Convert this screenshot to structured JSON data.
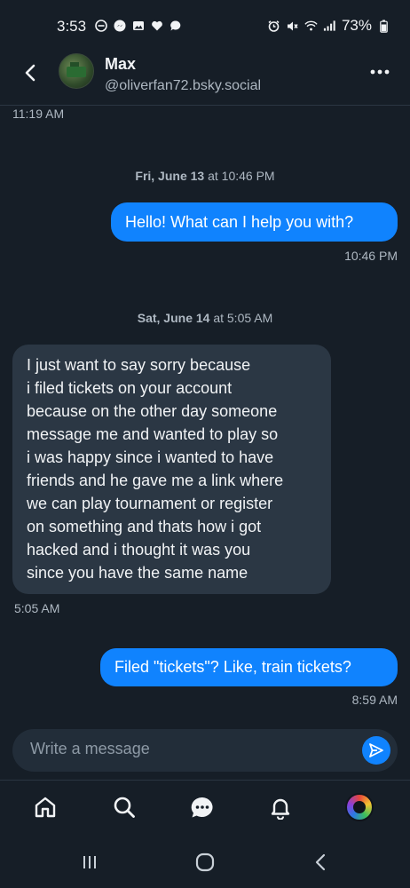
{
  "status_bar": {
    "time": "3:53",
    "battery": "73%"
  },
  "header": {
    "contact_name": "Max",
    "contact_handle": "@oliverfan72.bsky.social"
  },
  "chat": {
    "top_timestamp": "11:19 AM",
    "groups": [
      {
        "date_bold": "Fri, June 13",
        "date_rest": " at 10:46 PM",
        "messages": [
          {
            "from": "me",
            "text": "Hello! What can I help you with?",
            "time": "10:46 PM"
          }
        ]
      },
      {
        "date_bold": "Sat, June 14",
        "date_rest": " at 5:05 AM",
        "messages": [
          {
            "from": "them",
            "lines": [
              "I just want to say sorry because",
              "i filed tickets on your account",
              "because on the other day someone",
              "message me and wanted to play so",
              "i was happy since i wanted to have",
              "friends and he gave me a link where",
              "we can play tournament or register",
              "on something and thats how i got",
              "hacked and i thought it was you",
              "since you have the same name"
            ],
            "time": "5:05 AM"
          },
          {
            "from": "me",
            "text": "Filed \"tickets\"? Like, train tickets?",
            "time": "8:59 AM"
          }
        ]
      }
    ]
  },
  "composer": {
    "placeholder": "Write a message"
  },
  "colors": {
    "background": "#161e27",
    "my_bubble": "#1083fe",
    "their_bubble": "#2b3744",
    "accent": "#1083fe"
  }
}
